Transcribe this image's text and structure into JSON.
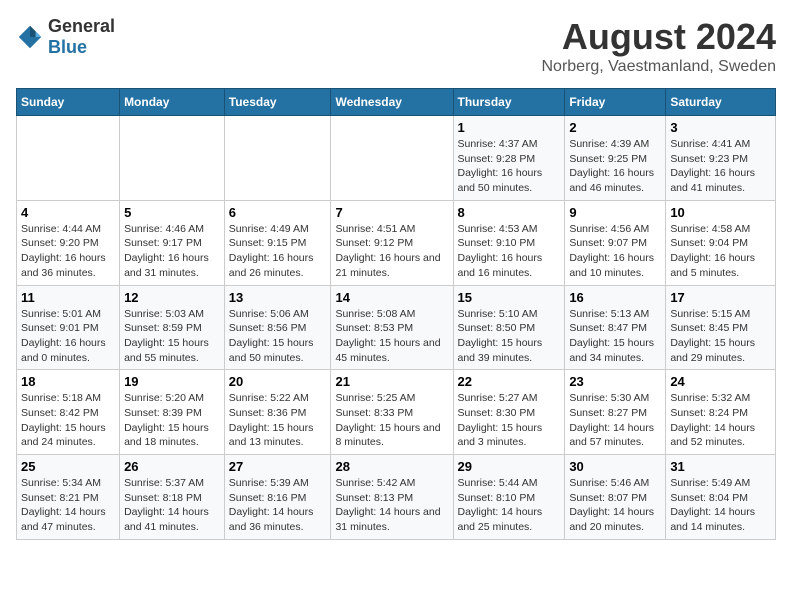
{
  "header": {
    "logo_general": "General",
    "logo_blue": "Blue",
    "title": "August 2024",
    "subtitle": "Norberg, Vaestmanland, Sweden"
  },
  "calendar": {
    "days_of_week": [
      "Sunday",
      "Monday",
      "Tuesday",
      "Wednesday",
      "Thursday",
      "Friday",
      "Saturday"
    ],
    "weeks": [
      [
        {
          "day": "",
          "content": ""
        },
        {
          "day": "",
          "content": ""
        },
        {
          "day": "",
          "content": ""
        },
        {
          "day": "",
          "content": ""
        },
        {
          "day": "1",
          "content": "Sunrise: 4:37 AM\nSunset: 9:28 PM\nDaylight: 16 hours and 50 minutes."
        },
        {
          "day": "2",
          "content": "Sunrise: 4:39 AM\nSunset: 9:25 PM\nDaylight: 16 hours and 46 minutes."
        },
        {
          "day": "3",
          "content": "Sunrise: 4:41 AM\nSunset: 9:23 PM\nDaylight: 16 hours and 41 minutes."
        }
      ],
      [
        {
          "day": "4",
          "content": "Sunrise: 4:44 AM\nSunset: 9:20 PM\nDaylight: 16 hours and 36 minutes."
        },
        {
          "day": "5",
          "content": "Sunrise: 4:46 AM\nSunset: 9:17 PM\nDaylight: 16 hours and 31 minutes."
        },
        {
          "day": "6",
          "content": "Sunrise: 4:49 AM\nSunset: 9:15 PM\nDaylight: 16 hours and 26 minutes."
        },
        {
          "day": "7",
          "content": "Sunrise: 4:51 AM\nSunset: 9:12 PM\nDaylight: 16 hours and 21 minutes."
        },
        {
          "day": "8",
          "content": "Sunrise: 4:53 AM\nSunset: 9:10 PM\nDaylight: 16 hours and 16 minutes."
        },
        {
          "day": "9",
          "content": "Sunrise: 4:56 AM\nSunset: 9:07 PM\nDaylight: 16 hours and 10 minutes."
        },
        {
          "day": "10",
          "content": "Sunrise: 4:58 AM\nSunset: 9:04 PM\nDaylight: 16 hours and 5 minutes."
        }
      ],
      [
        {
          "day": "11",
          "content": "Sunrise: 5:01 AM\nSunset: 9:01 PM\nDaylight: 16 hours and 0 minutes."
        },
        {
          "day": "12",
          "content": "Sunrise: 5:03 AM\nSunset: 8:59 PM\nDaylight: 15 hours and 55 minutes."
        },
        {
          "day": "13",
          "content": "Sunrise: 5:06 AM\nSunset: 8:56 PM\nDaylight: 15 hours and 50 minutes."
        },
        {
          "day": "14",
          "content": "Sunrise: 5:08 AM\nSunset: 8:53 PM\nDaylight: 15 hours and 45 minutes."
        },
        {
          "day": "15",
          "content": "Sunrise: 5:10 AM\nSunset: 8:50 PM\nDaylight: 15 hours and 39 minutes."
        },
        {
          "day": "16",
          "content": "Sunrise: 5:13 AM\nSunset: 8:47 PM\nDaylight: 15 hours and 34 minutes."
        },
        {
          "day": "17",
          "content": "Sunrise: 5:15 AM\nSunset: 8:45 PM\nDaylight: 15 hours and 29 minutes."
        }
      ],
      [
        {
          "day": "18",
          "content": "Sunrise: 5:18 AM\nSunset: 8:42 PM\nDaylight: 15 hours and 24 minutes."
        },
        {
          "day": "19",
          "content": "Sunrise: 5:20 AM\nSunset: 8:39 PM\nDaylight: 15 hours and 18 minutes."
        },
        {
          "day": "20",
          "content": "Sunrise: 5:22 AM\nSunset: 8:36 PM\nDaylight: 15 hours and 13 minutes."
        },
        {
          "day": "21",
          "content": "Sunrise: 5:25 AM\nSunset: 8:33 PM\nDaylight: 15 hours and 8 minutes."
        },
        {
          "day": "22",
          "content": "Sunrise: 5:27 AM\nSunset: 8:30 PM\nDaylight: 15 hours and 3 minutes."
        },
        {
          "day": "23",
          "content": "Sunrise: 5:30 AM\nSunset: 8:27 PM\nDaylight: 14 hours and 57 minutes."
        },
        {
          "day": "24",
          "content": "Sunrise: 5:32 AM\nSunset: 8:24 PM\nDaylight: 14 hours and 52 minutes."
        }
      ],
      [
        {
          "day": "25",
          "content": "Sunrise: 5:34 AM\nSunset: 8:21 PM\nDaylight: 14 hours and 47 minutes."
        },
        {
          "day": "26",
          "content": "Sunrise: 5:37 AM\nSunset: 8:18 PM\nDaylight: 14 hours and 41 minutes."
        },
        {
          "day": "27",
          "content": "Sunrise: 5:39 AM\nSunset: 8:16 PM\nDaylight: 14 hours and 36 minutes."
        },
        {
          "day": "28",
          "content": "Sunrise: 5:42 AM\nSunset: 8:13 PM\nDaylight: 14 hours and 31 minutes."
        },
        {
          "day": "29",
          "content": "Sunrise: 5:44 AM\nSunset: 8:10 PM\nDaylight: 14 hours and 25 minutes."
        },
        {
          "day": "30",
          "content": "Sunrise: 5:46 AM\nSunset: 8:07 PM\nDaylight: 14 hours and 20 minutes."
        },
        {
          "day": "31",
          "content": "Sunrise: 5:49 AM\nSunset: 8:04 PM\nDaylight: 14 hours and 14 minutes."
        }
      ]
    ]
  }
}
